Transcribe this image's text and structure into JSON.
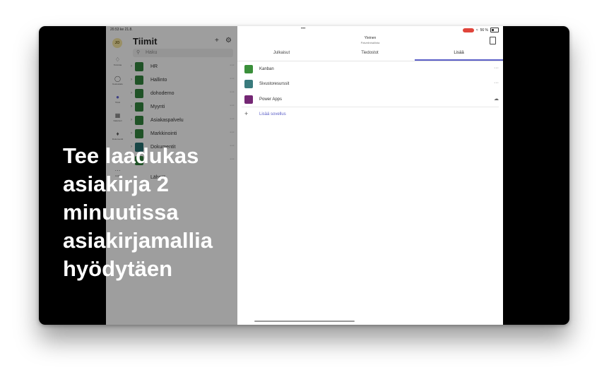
{
  "status": {
    "time": "20.53",
    "date": "ke 21.8.",
    "battery": "56 %",
    "dots": "•••"
  },
  "sidebar": {
    "avatar_initials": "JO",
    "title": "Tiimit",
    "rail": [
      {
        "label": "Toiminta",
        "icon": "bell-icon"
      },
      {
        "label": "Keskustelu",
        "icon": "chat-icon"
      },
      {
        "label": "Tiimit",
        "icon": "teams-icon"
      },
      {
        "label": "Kalenteri",
        "icon": "calendar-icon"
      },
      {
        "label": "Dokumentit",
        "icon": "document-icon"
      },
      {
        "label": "Lisää",
        "icon": "more-icon"
      }
    ],
    "search_placeholder": "Haku",
    "teams": [
      {
        "name": "HR"
      },
      {
        "name": "Hallinto"
      },
      {
        "name": "dohoderno"
      },
      {
        "name": "Myynti"
      },
      {
        "name": "Asiakaspalvelu"
      },
      {
        "name": "Markkinointi"
      },
      {
        "name": "Dokumentit"
      },
      {
        "name": ""
      }
    ],
    "extra": "Lähetä"
  },
  "channel": {
    "title": "Yleinen",
    "subtitle": "Palvelinhallinta"
  },
  "tabs": [
    {
      "label": "Julkaisut"
    },
    {
      "label": "Tiedostot"
    },
    {
      "label": "Lisää"
    }
  ],
  "apps": [
    {
      "name": "Kanban",
      "color": "#3a8f3a"
    },
    {
      "name": "Sivustoresurssit",
      "color": "#3a7b7d"
    },
    {
      "name": "Power Apps",
      "color": "#742774"
    }
  ],
  "add_app_label": "Lisää sovellus",
  "caption": [
    "Tee laadukas",
    "asiakirja 2",
    "minuutissa",
    "asiakirjamallia",
    "hyödytäen"
  ]
}
